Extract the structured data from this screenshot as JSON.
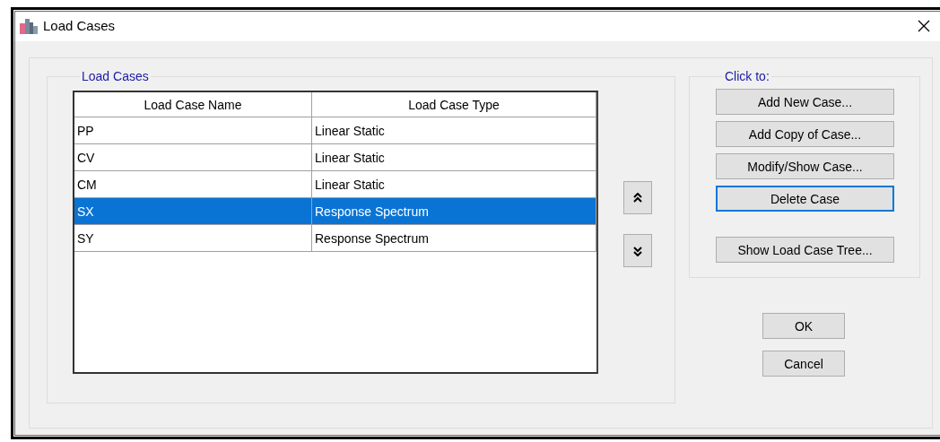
{
  "window": {
    "title": "Load Cases"
  },
  "load_cases": {
    "title": "Load Cases",
    "columns": [
      "Load Case Name",
      "Load Case Type"
    ],
    "rows": [
      {
        "name": "PP",
        "type": "Linear Static",
        "selected": false
      },
      {
        "name": "CV",
        "type": "Linear Static",
        "selected": false
      },
      {
        "name": "CM",
        "type": "Linear Static",
        "selected": false
      },
      {
        "name": "SX",
        "type": "Response Spectrum",
        "selected": true
      },
      {
        "name": "SY",
        "type": "Response Spectrum",
        "selected": false
      }
    ]
  },
  "click_to": {
    "title": "Click to:",
    "buttons": [
      {
        "label": "Add New Case...",
        "focused": false
      },
      {
        "label": "Add Copy of Case...",
        "focused": false
      },
      {
        "label": "Modify/Show Case...",
        "focused": false
      },
      {
        "label": "Delete Case",
        "focused": true
      },
      {
        "label": "Show Load Case Tree...",
        "focused": false,
        "kind": "separated"
      }
    ]
  },
  "buttons": [
    "OK",
    "Cancel"
  ]
}
